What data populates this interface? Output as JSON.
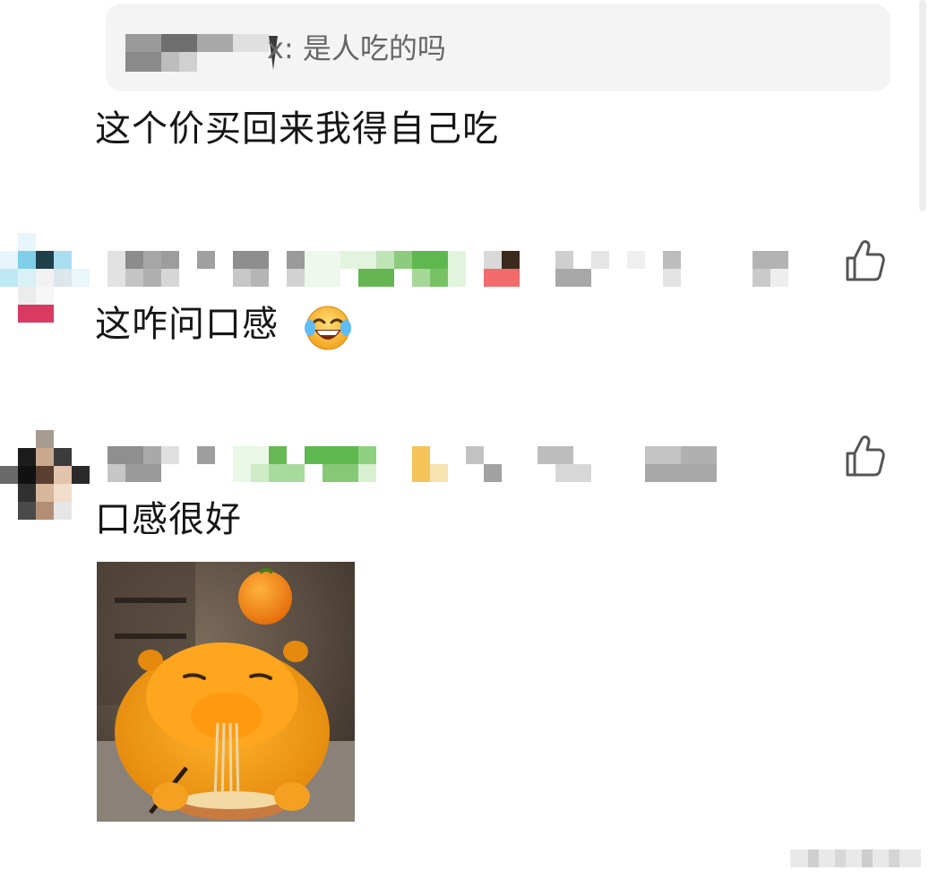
{
  "quote": {
    "text": "x: 是人吃的吗"
  },
  "comments": [
    {
      "text": "这个价买回来我得自己吃"
    },
    {
      "text": "这咋问口感",
      "emoji": "face-with-tears-of-joy-icon"
    },
    {
      "text": "口感很好",
      "sticker": "orange-capybara-eating-noodles"
    }
  ],
  "icons": {
    "like": "thumbs-up-icon"
  },
  "colors": {
    "quote_background": "#f4f4f4",
    "text": "#161616",
    "quote_text": "#666666",
    "username_accent": "#5fb84f"
  }
}
